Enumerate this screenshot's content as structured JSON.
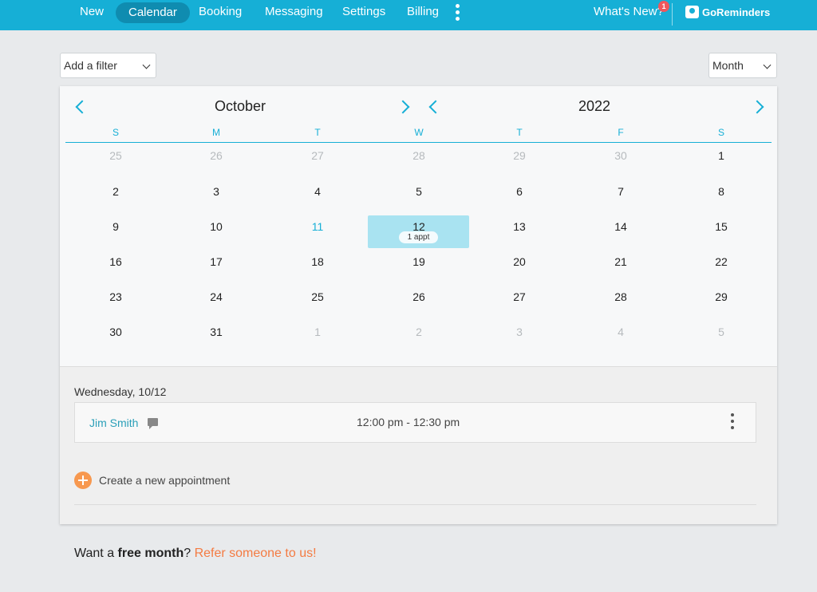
{
  "nav": {
    "items": [
      "New",
      "Calendar",
      "Booking",
      "Messaging",
      "Settings",
      "Billing"
    ],
    "active": "Calendar",
    "whats_new": "What's New?",
    "whats_new_badge": "1",
    "brand": "GoReminders"
  },
  "toolbar": {
    "filter_label": "Add a filter",
    "view_label": "Month"
  },
  "calendar": {
    "month": "October",
    "year": "2022",
    "weekdays": [
      "S",
      "M",
      "T",
      "W",
      "T",
      "F",
      "S"
    ],
    "weeks": [
      [
        "25",
        "26",
        "27",
        "28",
        "29",
        "30",
        "1"
      ],
      [
        "2",
        "3",
        "4",
        "5",
        "6",
        "7",
        "8"
      ],
      [
        "9",
        "10",
        "11",
        "12",
        "13",
        "14",
        "15"
      ],
      [
        "16",
        "17",
        "18",
        "19",
        "20",
        "21",
        "22"
      ],
      [
        "23",
        "24",
        "25",
        "26",
        "27",
        "28",
        "29"
      ],
      [
        "30",
        "31",
        "1",
        "2",
        "3",
        "4",
        "5"
      ]
    ],
    "selected_appt_label": "1 appt",
    "accent": "#16afd6"
  },
  "day_panel": {
    "date_title": "Wednesday, 10/12",
    "appointments": [
      {
        "name": "Jim Smith",
        "time": "12:00 pm - 12:30 pm"
      }
    ],
    "create_label": "Create a new appointment"
  },
  "referral": {
    "prefix": "Want a ",
    "bold": "free month",
    "suffix": "? ",
    "link": "Refer someone to us!"
  }
}
